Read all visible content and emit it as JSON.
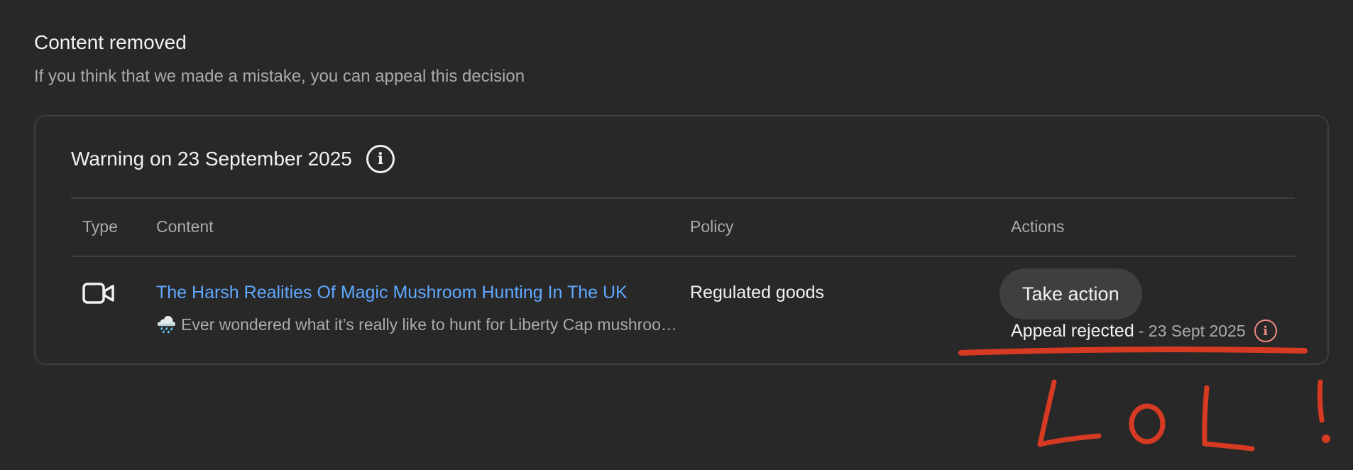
{
  "header": {
    "title": "Content removed",
    "subtitle": "If you think that we made a mistake, you can appeal this decision"
  },
  "warning": {
    "title": "Warning on 23 September 2025",
    "info_icon": "info-icon"
  },
  "table": {
    "headers": {
      "type": "Type",
      "content": "Content",
      "policy": "Policy",
      "actions": "Actions"
    },
    "row": {
      "type_icon": "video-camera-icon",
      "content_title": "The Harsh Realities Of Magic Mushroom Hunting In The UK",
      "content_desc": "🌧️ Ever wondered what it’s really like to hunt for Liberty Cap mushrooms in the UK? Come along for the hunt",
      "policy": "Regulated goods",
      "action_button": "Take action",
      "appeal_status": "Appeal rejected",
      "appeal_date": "- 23 Sept 2025",
      "appeal_info_icon": "info-icon"
    }
  },
  "annotation": {
    "text": "LOL!",
    "color": "#d63a22"
  },
  "colors": {
    "background": "#282828",
    "link": "#5fa8ff",
    "muted": "#aaaaaa",
    "alert": "#f28b82"
  }
}
